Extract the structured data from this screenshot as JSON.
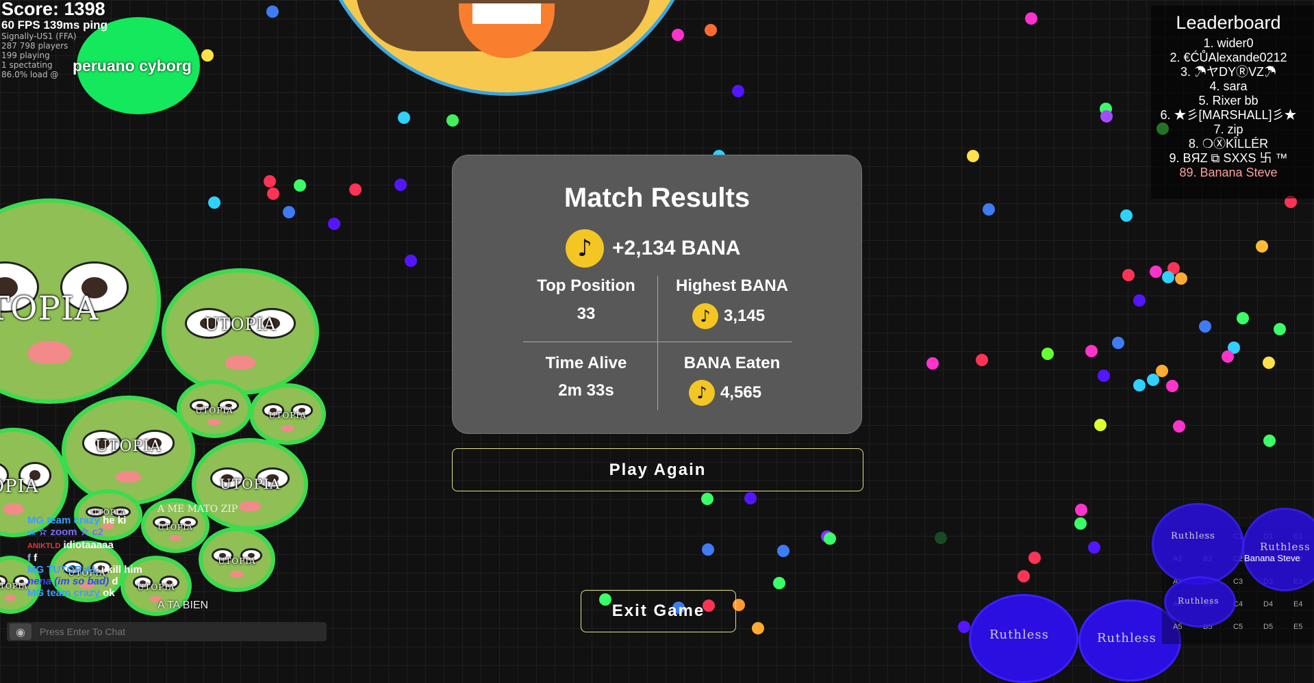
{
  "hud": {
    "score": "Score: 1398",
    "fps_ping": "60 FPS 139ms ping",
    "server": "Signally-US1 (FFA)",
    "players": "287 798 players",
    "playing": "199 playing",
    "spectating": "1 spectating",
    "load": "86.0% load @"
  },
  "player_name_label": "peruano cyborg",
  "clan_tag": "UTOPIA",
  "other_labels": {
    "amor": "A ME MATO ZIP",
    "ta_bien": "A TA BIEN",
    "ruthless": "Ruthless",
    "banana_steve": "Banana Steve"
  },
  "leaderboard": {
    "title": "Leaderboard",
    "entries": [
      "1. wider0",
      "2. €ĆŮAlexande0212",
      "3. ☂ヤDYⓇVZ☂",
      "4. sara",
      "5. Rixer bb",
      "6. ★彡[MARSHALL]彡★",
      "7. zip",
      "8. ❍ⓍKÎLLÉR",
      "9. BЯZ ⧉ SXXS 卐 ™"
    ],
    "self_entry": "89. Banana Steve",
    "self_color": "#ff9f9f"
  },
  "match_results": {
    "title": "Match Results",
    "reward": "+2,134 BANA",
    "top_position_label": "Top Position",
    "top_position_value": "33",
    "highest_bana_label": "Highest BANA",
    "highest_bana_value": "3,145",
    "time_alive_label": "Time Alive",
    "time_alive_value": "2m 33s",
    "bana_eaten_label": "BANA Eaten",
    "bana_eaten_value": "4,565",
    "coin_icon": "bana-coin-icon"
  },
  "buttons": {
    "play_again": "Play Again",
    "exit_game": "Exit Game"
  },
  "chat": {
    "messages": [
      {
        "name": "MG team crazy",
        "text": "he ki",
        "color": "#3aa0ff"
      },
      {
        "name": "ok",
        "text": "☆ zoom ☆ c2",
        "color": "#3aa0ff"
      },
      {
        "name": "ANIKTLD",
        "text": "idiotaaaaa",
        "color": "#e33"
      },
      {
        "name": "f",
        "text": "f",
        "color": "#9ad"
      },
      {
        "name": "MG TUTORIAL",
        "text": "i kill him",
        "color": "#3aa0ff"
      },
      {
        "name": "nena (im so bad)",
        "text": "d",
        "color": "#3344ff"
      },
      {
        "name": "MG team crazy",
        "text": "ok",
        "color": "#3aa0ff"
      }
    ],
    "placeholder": "Press Enter To Chat"
  },
  "minimap": {
    "cols": [
      "A",
      "B",
      "C",
      "D",
      "E"
    ],
    "rows": [
      "1",
      "2",
      "3",
      "4",
      "5"
    ]
  }
}
